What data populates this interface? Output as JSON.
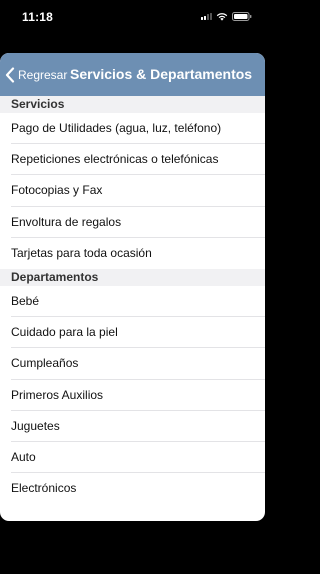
{
  "status_bar": {
    "time": "11:18"
  },
  "nav": {
    "back_label": "Regresar",
    "title": "Servicios & Departamentos"
  },
  "sections": [
    {
      "header": "Servicios",
      "items": [
        "Pago de Utilidades (agua, luz, teléfono)",
        "Repeticiones electrónicas o telefónicas",
        "Fotocopias y Fax",
        "Envoltura de regalos",
        "Tarjetas para toda ocasión"
      ]
    },
    {
      "header": "Departamentos",
      "items": [
        "Bebé",
        "Cuidado para la piel",
        "Cumpleaños",
        "Primeros Auxilios",
        "Juguetes",
        "Auto",
        "Electrónicos"
      ]
    }
  ]
}
